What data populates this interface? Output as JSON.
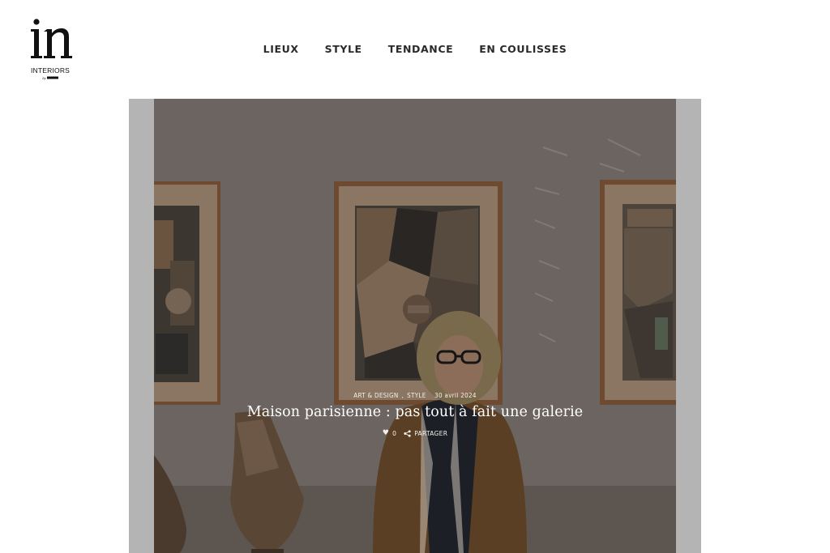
{
  "brand": {
    "logo_letters": "in",
    "logo_word": "INTERIORS",
    "logo_byline": "by"
  },
  "nav": {
    "items": [
      {
        "label": "LIEUX"
      },
      {
        "label": "STYLE"
      },
      {
        "label": "TENDANCE"
      },
      {
        "label": "EN COULISSES"
      }
    ]
  },
  "article": {
    "categories": [
      "ART & DESIGN",
      "STYLE"
    ],
    "category_separator": ",",
    "date": "30 avril 2024",
    "title": "Maison parisienne : pas tout à fait une galerie",
    "likes": "0",
    "share_label": "PARTAGER"
  },
  "colors": {
    "nav_text": "#2a2a2a",
    "hero_frame": "#b4b4b4",
    "overlay_text": "#ffffff"
  },
  "icons": {
    "like": "heart-icon",
    "share": "share-icon"
  }
}
